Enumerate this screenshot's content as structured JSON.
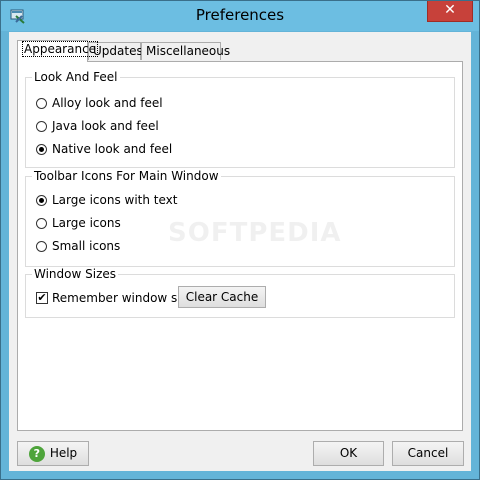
{
  "window": {
    "title": "Preferences",
    "close_label": "✕"
  },
  "tabs": [
    {
      "label": "Appearance",
      "active": true
    },
    {
      "label": "Updates",
      "active": false
    },
    {
      "label": "Miscellaneous",
      "active": false
    }
  ],
  "look_and_feel": {
    "title": "Look And Feel",
    "options": [
      {
        "label": "Alloy look and feel",
        "checked": false
      },
      {
        "label": "Java look and feel",
        "checked": false
      },
      {
        "label": "Native look and feel",
        "checked": true
      }
    ]
  },
  "toolbar_icons": {
    "title": "Toolbar Icons For Main Window",
    "options": [
      {
        "label": "Large icons with text",
        "checked": true
      },
      {
        "label": "Large icons",
        "checked": false
      },
      {
        "label": "Small icons",
        "checked": false
      }
    ]
  },
  "window_sizes": {
    "title": "Window Sizes",
    "remember_label": "Remember window sizes",
    "remember_checked": true,
    "clear_cache_label": "Clear Cache"
  },
  "buttons": {
    "help": "Help",
    "ok": "OK",
    "cancel": "Cancel"
  },
  "watermark": "SOFTPEDIA"
}
